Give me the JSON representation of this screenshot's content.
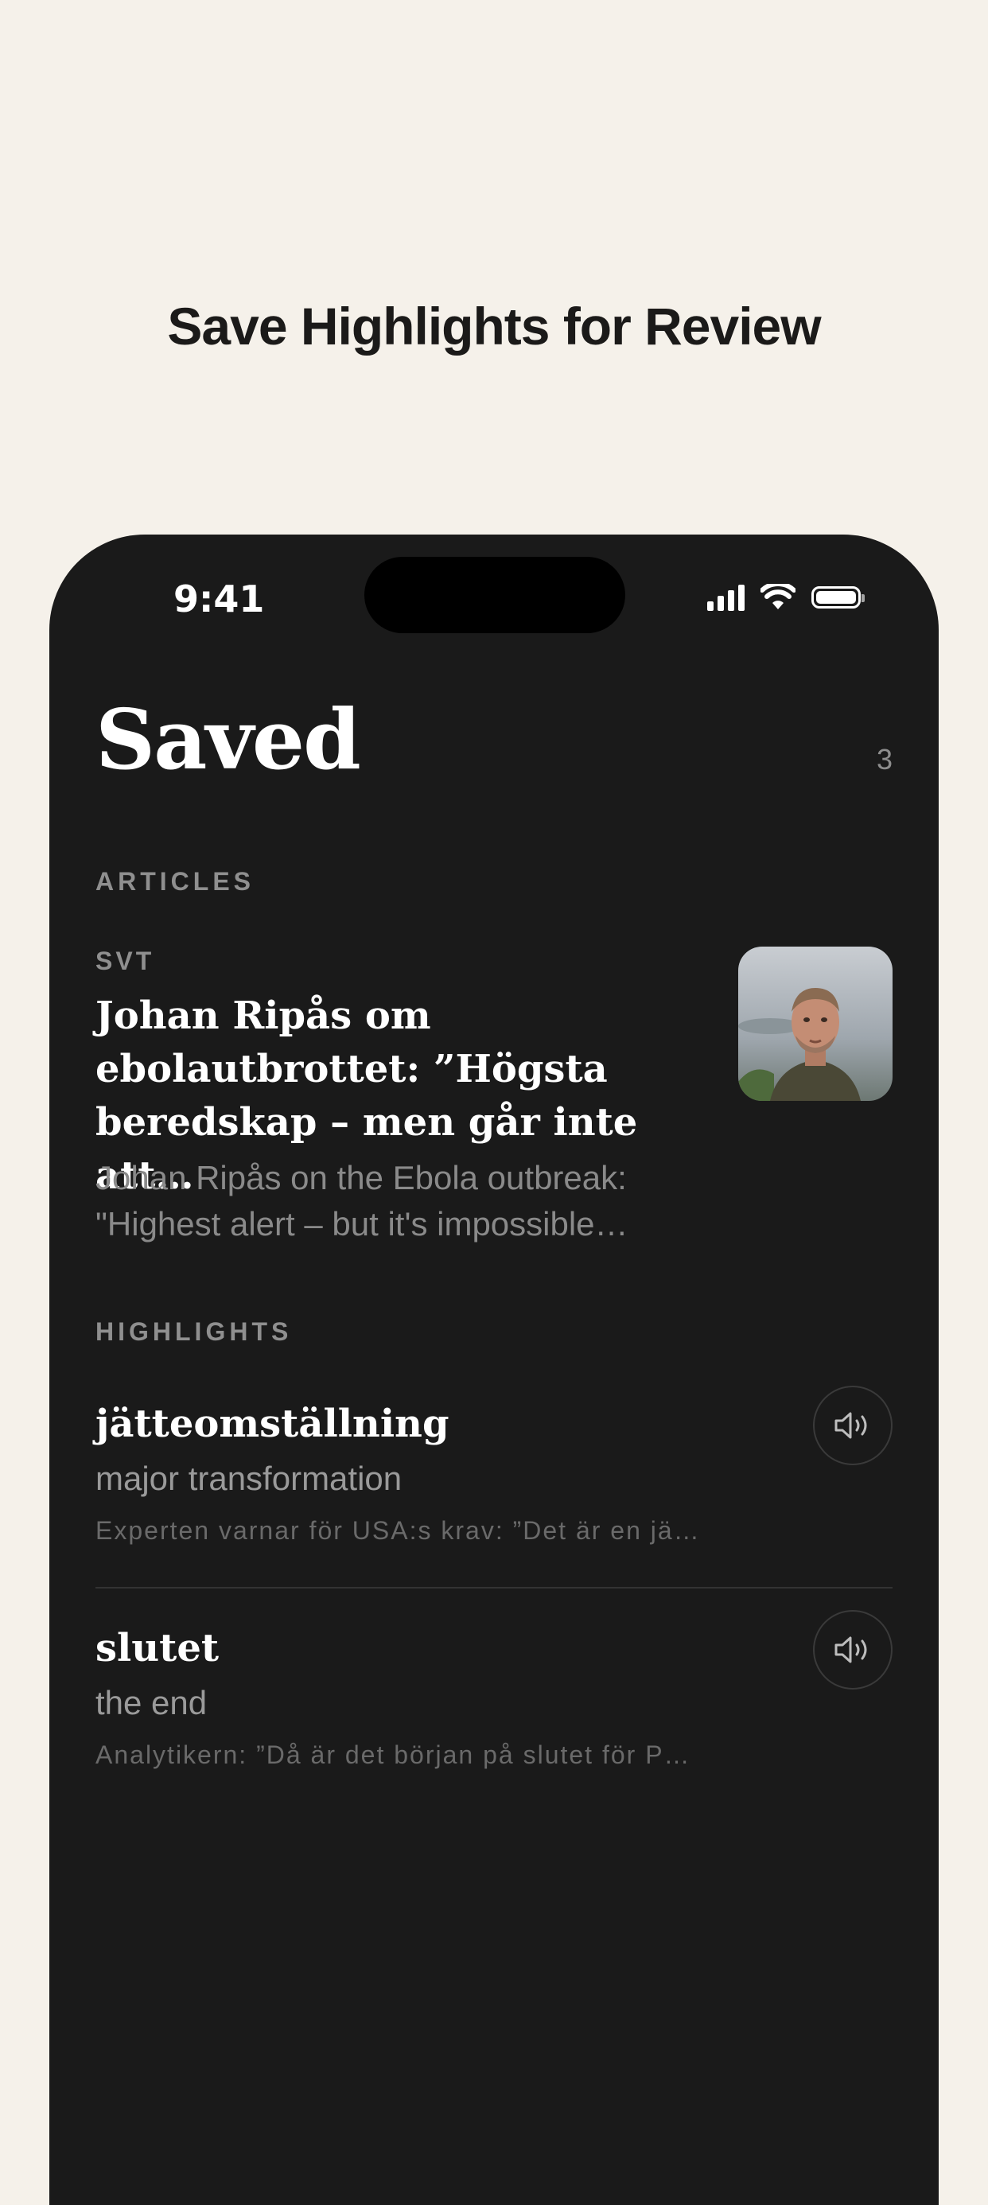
{
  "headline": "Save Highlights for Review",
  "status": {
    "time": "9:41"
  },
  "screen": {
    "title": "Saved",
    "count": "3",
    "articles_label": "ARTICLES",
    "highlights_label": "HIGHLIGHTS"
  },
  "article": {
    "source": "SVT",
    "title": "Johan Ripås om ebolautbrottet: ”Högsta beredskap – men går inte att…",
    "translation": "Johan Ripås on the Ebola outbreak: \"Highest alert – but it's impossible…"
  },
  "highlights": [
    {
      "word": "jätteomställning",
      "translation": "major transformation",
      "context": "Experten varnar för USA:s krav: ”Det är en jä…"
    },
    {
      "word": "slutet",
      "translation": "the end",
      "context": "Analytikern: ”Då är det början på slutet för P…"
    }
  ],
  "icons": {
    "speaker": "speaker-icon",
    "signal": "cellular-signal-icon",
    "wifi": "wifi-icon",
    "battery": "battery-icon"
  }
}
